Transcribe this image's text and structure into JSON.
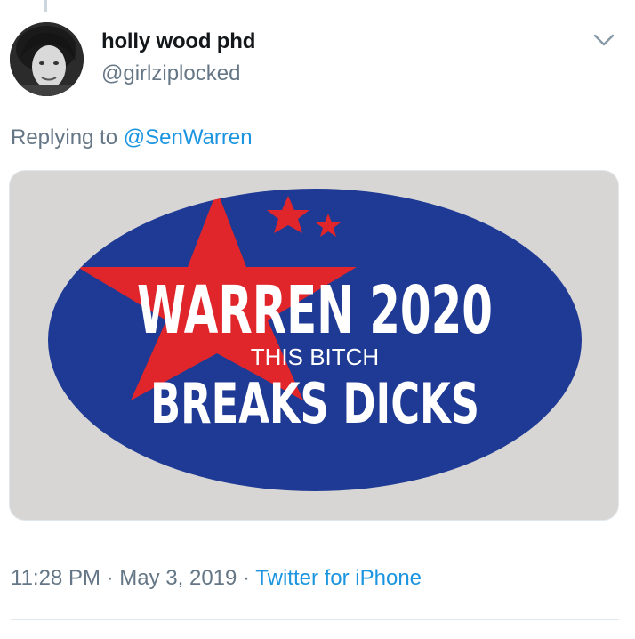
{
  "tweet": {
    "display_name": "holly wood phd",
    "handle": "@girlziplocked",
    "replying_prefix": "Replying to",
    "replying_to": "@SenWarren",
    "time": "11:28 PM",
    "separator1": " · ",
    "date": "May 3, 2019",
    "separator2": " · ",
    "source": "Twitter for iPhone"
  },
  "sticker": {
    "line1": "WARREN 2020",
    "line2": "THIS BITCH",
    "line3": "BREAKS DICKS",
    "colors": {
      "oval": "#1e3a94",
      "star": "#e0262b",
      "text": "#ffffff",
      "background": "#d8d6d5"
    }
  },
  "icons": {
    "avatar": "avatar-photo",
    "menu": "chevron-down-icon"
  }
}
